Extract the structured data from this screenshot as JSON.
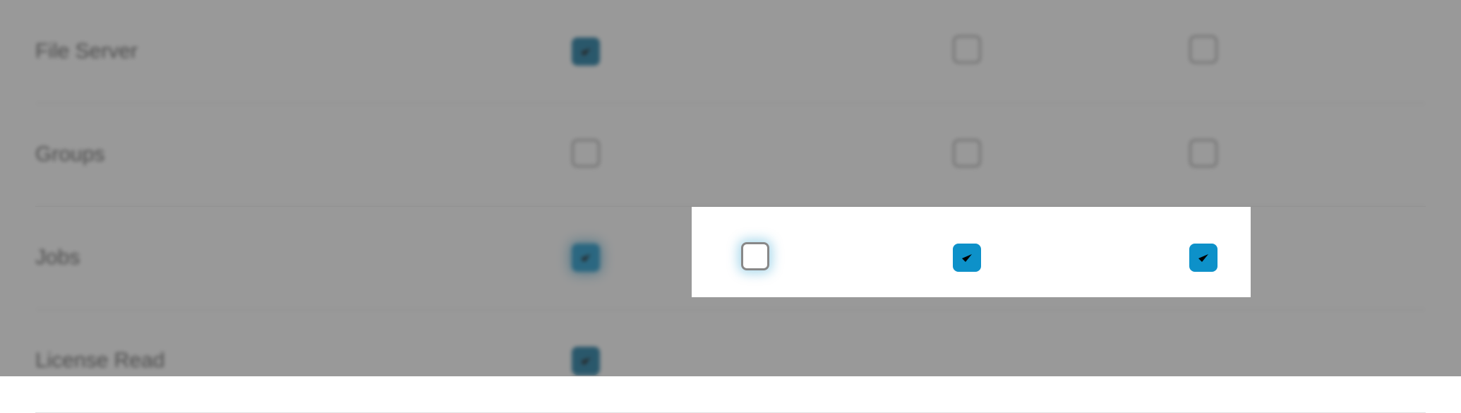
{
  "colors": {
    "accent": "#0d91c9",
    "accentDark": "#0a6f9a",
    "border": "#a8a8a8",
    "text": "#555"
  },
  "rows": [
    {
      "label": "File Server",
      "cells": [
        {
          "checked": true,
          "style": "dark"
        },
        null,
        {
          "checked": false,
          "style": "plain"
        },
        {
          "checked": false,
          "style": "plain"
        }
      ]
    },
    {
      "label": "Groups",
      "cells": [
        {
          "checked": false,
          "style": "plain"
        },
        null,
        {
          "checked": false,
          "style": "plain"
        },
        {
          "checked": false,
          "style": "plain"
        }
      ]
    },
    {
      "label": "Jobs",
      "cells": [
        {
          "checked": true,
          "style": "glow"
        },
        {
          "checked": false,
          "style": "glow"
        },
        {
          "checked": true,
          "style": "plain"
        },
        {
          "checked": true,
          "style": "plain"
        }
      ]
    },
    {
      "label": "License Read",
      "cells": [
        {
          "checked": true,
          "style": "dark"
        },
        null,
        null,
        null
      ]
    }
  ]
}
